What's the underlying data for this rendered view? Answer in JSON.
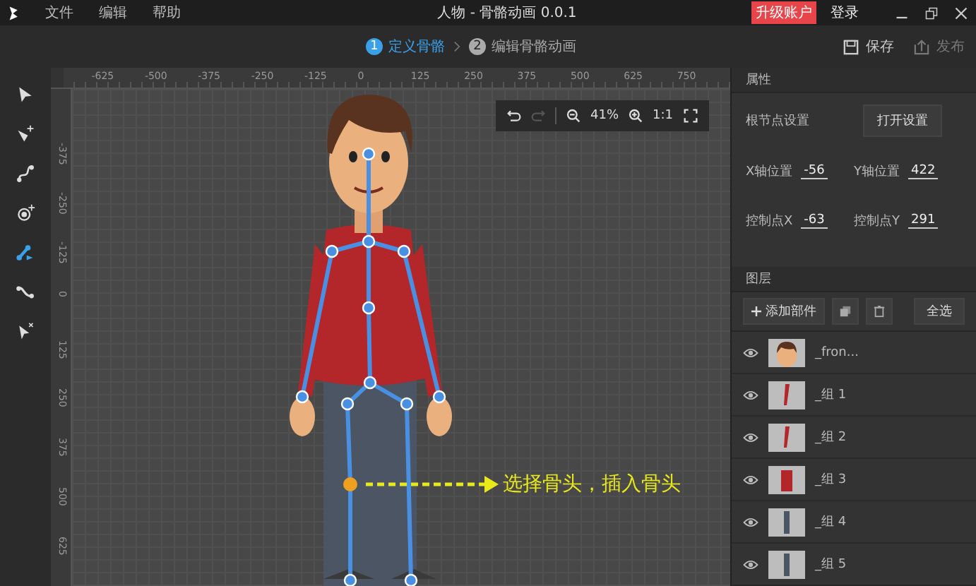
{
  "window": {
    "title": "人物 - 骨骼动画 0.0.1"
  },
  "menu": [
    "文件",
    "编辑",
    "帮助"
  ],
  "account": {
    "upgrade": "升级账户",
    "login": "登录"
  },
  "steps": [
    {
      "number": "1",
      "label": "定义骨骼",
      "selected": true
    },
    {
      "number": "2",
      "label": "编辑骨骼动画",
      "selected": false
    }
  ],
  "actions": [
    {
      "kind": "save",
      "label": "保存",
      "disabled": false
    },
    {
      "kind": "publish",
      "label": "发布",
      "disabled": true
    }
  ],
  "tools": [
    {
      "kind": "select",
      "selected": false
    },
    {
      "kind": "add-point",
      "selected": false
    },
    {
      "kind": "curve",
      "selected": false
    },
    {
      "kind": "add-joint",
      "selected": false
    },
    {
      "kind": "bone",
      "selected": true
    },
    {
      "kind": "path",
      "selected": false
    },
    {
      "kind": "delete-select",
      "selected": false
    }
  ],
  "ruler": {
    "x_ticks": [
      "-625",
      "-500",
      "-375",
      "-250",
      "-125",
      "0",
      "125",
      "250",
      "375",
      "500",
      "625",
      "750"
    ],
    "y_ticks": [
      "-375",
      "-250",
      "-125",
      "0",
      "125",
      "250",
      "375",
      "500",
      "625"
    ]
  },
  "zoom_bar": {
    "zoom": "41%",
    "actual_size": "1:1",
    "redo_disabled": true
  },
  "annotation": "选择骨头，插入骨头",
  "properties": {
    "title": "属性",
    "root_label": "根节点设置",
    "open_button": "打开设置",
    "fields": [
      {
        "label": "X轴位置",
        "value": "-56"
      },
      {
        "label": "Y轴位置",
        "value": "422"
      },
      {
        "label": "控制点X",
        "value": "-63"
      },
      {
        "label": "控制点Y",
        "value": "291"
      }
    ]
  },
  "layers": {
    "title": "图层",
    "add_button": "添加部件",
    "select_all": "全选",
    "items": [
      {
        "name": "_fron...",
        "visible": true,
        "kind": "head"
      },
      {
        "name": "_组 1",
        "visible": true,
        "kind": "arm"
      },
      {
        "name": "_组 2",
        "visible": true,
        "kind": "arm"
      },
      {
        "name": "_组 3",
        "visible": true,
        "kind": "body"
      },
      {
        "name": "_组 4",
        "visible": true,
        "kind": "leg"
      },
      {
        "name": "_组 5",
        "visible": true,
        "kind": "leg"
      }
    ]
  }
}
